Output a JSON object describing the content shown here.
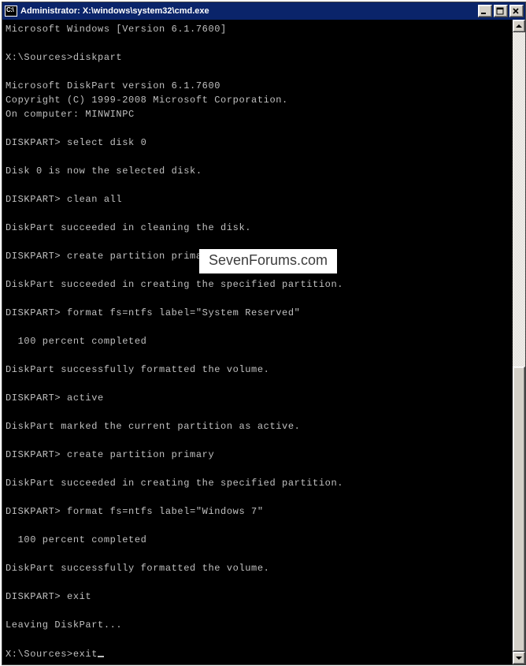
{
  "titlebar": {
    "icon_label": "C:\\",
    "title": "Administrator: X:\\windows\\system32\\cmd.exe",
    "min_label": "Minimize",
    "max_label": "Maximize",
    "close_label": "Close"
  },
  "watermark": "SevenForums.com",
  "scrollbar": {
    "thumb_top_pct": 54,
    "thumb_height_pct": 46
  },
  "lines": [
    "Microsoft Windows [Version 6.1.7600]",
    "",
    "X:\\Sources>diskpart",
    "",
    "Microsoft DiskPart version 6.1.7600",
    "Copyright (C) 1999-2008 Microsoft Corporation.",
    "On computer: MINWINPC",
    "",
    "DISKPART> select disk 0",
    "",
    "Disk 0 is now the selected disk.",
    "",
    "DISKPART> clean all",
    "",
    "DiskPart succeeded in cleaning the disk.",
    "",
    "DISKPART> create partition primary align=64 size=200",
    "",
    "DiskPart succeeded in creating the specified partition.",
    "",
    "DISKPART> format fs=ntfs label=\"System Reserved\"",
    "",
    "  100 percent completed",
    "",
    "DiskPart successfully formatted the volume.",
    "",
    "DISKPART> active",
    "",
    "DiskPart marked the current partition as active.",
    "",
    "DISKPART> create partition primary",
    "",
    "DiskPart succeeded in creating the specified partition.",
    "",
    "DISKPART> format fs=ntfs label=\"Windows 7\"",
    "",
    "  100 percent completed",
    "",
    "DiskPart successfully formatted the volume.",
    "",
    "DISKPART> exit",
    "",
    "Leaving DiskPart...",
    "",
    "X:\\Sources>exit"
  ]
}
